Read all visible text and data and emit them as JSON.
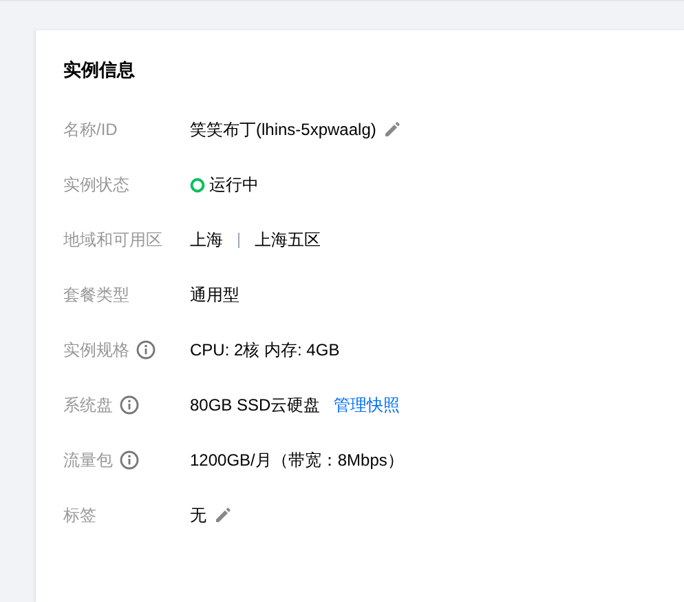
{
  "card": {
    "title": "实例信息",
    "rows": [
      {
        "label": "名称/ID",
        "info": false,
        "kind": "editable",
        "value": "笑笑布丁(lhins-5xpwaalg)"
      },
      {
        "label": "实例状态",
        "info": false,
        "kind": "status",
        "value": "运行中"
      },
      {
        "label": "地域和可用区",
        "info": false,
        "kind": "region",
        "parts": [
          "上海",
          "上海五区"
        ]
      },
      {
        "label": "套餐类型",
        "info": false,
        "kind": "text",
        "value": "通用型"
      },
      {
        "label": "实例规格",
        "info": true,
        "kind": "text",
        "value": "CPU: 2核 内存: 4GB"
      },
      {
        "label": "系统盘",
        "info": true,
        "kind": "link",
        "value": "80GB SSD云硬盘",
        "link": "管理快照"
      },
      {
        "label": "流量包",
        "info": true,
        "kind": "text",
        "value": "1200GB/月（带宽：8Mbps）"
      },
      {
        "label": "标签",
        "info": false,
        "kind": "editable",
        "value": "无"
      }
    ]
  }
}
